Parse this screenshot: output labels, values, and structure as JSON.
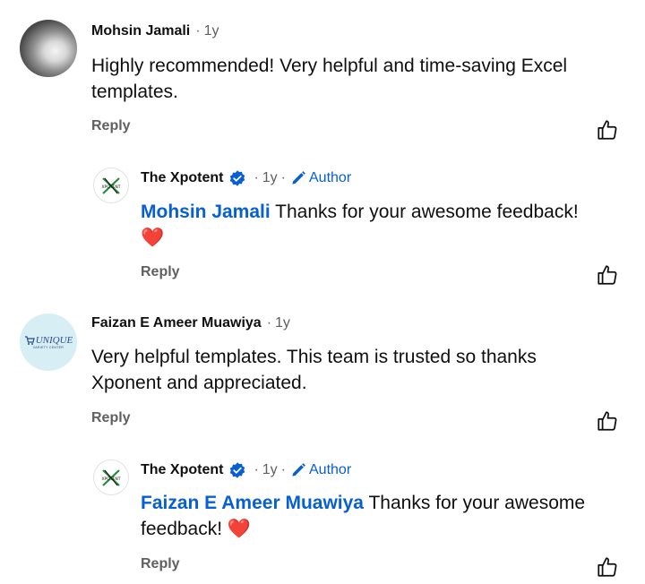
{
  "comments": [
    {
      "author": "Mohsin Jamali",
      "time": "1y",
      "text_line1": "Highly recommended! Very helpful and time-saving Excel",
      "text_line2": "templates.",
      "reply_label": "Reply",
      "replies": [
        {
          "author": "The Xpotent",
          "time": "1y",
          "badge": "Author",
          "mention": "Mohsin Jamali",
          "text": "Thanks for your awesome feedback!",
          "emoji": "❤️",
          "reply_label": "Reply"
        }
      ]
    },
    {
      "author": "Faizan E Ameer Muawiya",
      "time": "1y",
      "avatar_text": "UNIQUE",
      "avatar_subtext": "VARIETY CENTER",
      "text_line1": "Very helpful templates. This team is trusted so thanks",
      "text_line2": "Xponent and appreciated.",
      "reply_label": "Reply",
      "replies": [
        {
          "author": "The Xpotent",
          "time": "1y",
          "badge": "Author",
          "mention": "Faizan E Ameer Muawiya",
          "text_line1": "Thanks for your awesome",
          "text_line2": "feedback!",
          "emoji": "❤️",
          "reply_label": "Reply"
        }
      ]
    }
  ],
  "separator": "·",
  "reply_avatar_text": "XPOTENT",
  "colors": {
    "link": "#065fd4",
    "muted": "#606060",
    "text": "#0f0f0f",
    "heart": "#e02424"
  },
  "icons": [
    "like-icon",
    "verified-icon",
    "pencil-icon",
    "heart-icon"
  ]
}
